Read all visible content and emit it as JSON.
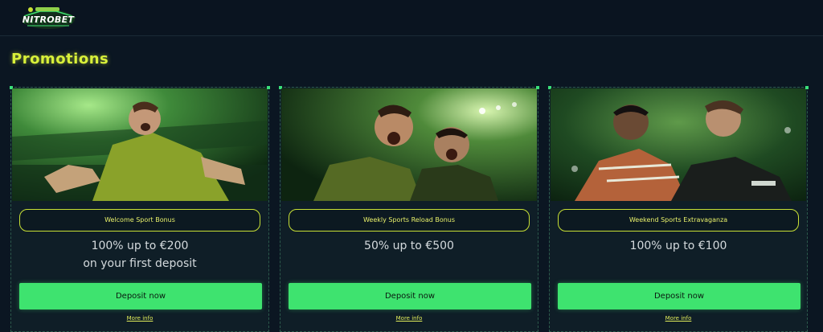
{
  "header": {
    "logo_text": "NITROBET"
  },
  "page": {
    "title": "Promotions"
  },
  "promotions": [
    {
      "title": "Welcome Sport Bonus",
      "offer_line1": "100% up to €200",
      "offer_line2": "on your first deposit",
      "button_label": "Deposit now",
      "link_label": "More info"
    },
    {
      "title": "Weekly Sports Reload Bonus",
      "offer_line1": "50% up to €500",
      "offer_line2": "",
      "button_label": "Deposit now",
      "link_label": "More info"
    },
    {
      "title": "Weekend Sports Extravaganza",
      "offer_line1": "100% up to €100",
      "offer_line2": "",
      "button_label": "Deposit now",
      "link_label": "More info"
    }
  ],
  "colors": {
    "background": "#0b1622",
    "accent_yellow": "#d8f03a",
    "button_green": "#3ee36f",
    "card_bg": "#0f1e27"
  }
}
